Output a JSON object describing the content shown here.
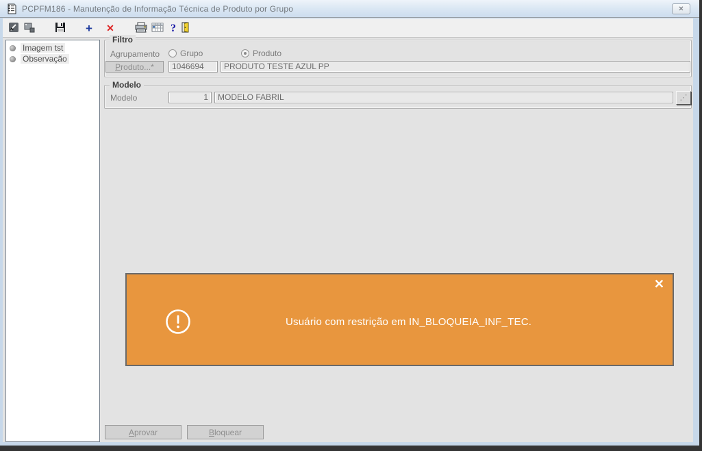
{
  "window": {
    "title": "PCPFM186 - Manutenção de Informação Técnica de Produto por Grupo",
    "close_glyph": "✕"
  },
  "toolbar": {
    "icons": [
      {
        "name": "select-arrow"
      },
      {
        "name": "cascade-windows"
      },
      {
        "name": "save"
      },
      {
        "name": "add",
        "glyph": "+"
      },
      {
        "name": "delete",
        "glyph": "✕"
      },
      {
        "name": "print"
      },
      {
        "name": "grid"
      },
      {
        "name": "help",
        "glyph": "?"
      },
      {
        "name": "exit"
      }
    ]
  },
  "sidebar": {
    "items": [
      {
        "label": "Imagem tst"
      },
      {
        "label": "Observação"
      }
    ]
  },
  "filtro": {
    "legend": "Filtro",
    "agrupamento_label": "Agrupamento",
    "radio_grupo": {
      "label": "Grupo",
      "selected": false
    },
    "radio_produto": {
      "label": "Produto",
      "selected": true
    },
    "produto_button_label": "Produto...*",
    "produto_code": "1046694",
    "produto_desc": "PRODUTO TESTE AZUL PP"
  },
  "modelo": {
    "legend": "Modelo",
    "label": "Modelo",
    "code": "1",
    "desc": "MODELO FABRIL",
    "ellipsis_glyph": "⋰"
  },
  "toast": {
    "message": "Usuário com restrição em IN_BLOQUEIA_INF_TEC.",
    "close_glyph": "✕",
    "background": "#E8963E"
  },
  "footer": {
    "aprovar_label": "Aprovar",
    "bloquear_label": "Bloquear"
  },
  "colors": {
    "frame_blue": "#c7d8ea",
    "content_gray": "#e3e3e3",
    "toast_orange": "#E8963E"
  }
}
